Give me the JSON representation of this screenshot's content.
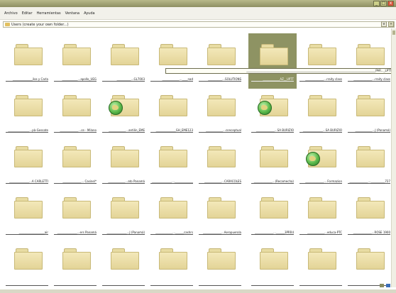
{
  "window": {
    "minimize": "_",
    "maximize": "□",
    "close": "x"
  },
  "menu": [
    "Archivo",
    "Editar",
    "Herramientas",
    "Ventana",
    "Ayuda"
  ],
  "address": {
    "text": "Users (create your own folder...)",
    "arrow": "v",
    "go": "»"
  },
  "rename_field": "___________________________________________________________________________________________PAR..._LPTT",
  "rows": [
    [
      {
        "label": "______________ilos y Carla",
        "globe": false
      },
      {
        "label": "___________...apollo_UEG",
        "globe": false
      },
      {
        "label": "__________...GL7003",
        "globe": false
      },
      {
        "label": "____________...____nad",
        "globe": false
      },
      {
        "label": "__________...SOLUTIONS",
        "globe": false
      },
      {
        "label": "____________AZ__UPTT",
        "globe": false,
        "selected": true
      },
      {
        "label": "_____________...rraity class",
        "globe": false
      },
      {
        "label": "_____________...rraity class",
        "globe": false
      }
    ],
    [
      {
        "label": "_______________...pà-Gessate",
        "globe": false
      },
      {
        "label": "_____________...ce - Milano",
        "globe": false
      },
      {
        "label": "____________...antilin_EME",
        "globe": true
      },
      {
        "label": "______________GH_EME123",
        "globe": false
      },
      {
        "label": "____________...conceptual",
        "globe": false
      },
      {
        "label": "_____________...SA BURIZIO",
        "globe": true
      },
      {
        "label": "______________...SA BURIZIO",
        "globe": false
      },
      {
        "label": "____________...J (Panamá)",
        "globe": false
      }
    ],
    [
      {
        "label": "______________...A CARLETTI",
        "globe": false
      },
      {
        "label": "_____________... Casinel*",
        "globe": false
      },
      {
        "label": "____________...ato Panamá",
        "globe": false
      },
      {
        "label": "______________..._____________",
        "globe": false
      },
      {
        "label": "____________...CARACOLES",
        "globe": false
      },
      {
        "label": "_____________...(Recamecha)",
        "globe": false
      },
      {
        "label": "_____________... Formazion",
        "globe": true
      },
      {
        "label": "_____________...__________727",
        "globe": false
      }
    ],
    [
      {
        "label": "__________________air",
        "globe": false
      },
      {
        "label": "______________...ers Panamá",
        "globe": false
      },
      {
        "label": "______________...J (Panamá)",
        "globe": false
      },
      {
        "label": "____________...______cashrs",
        "globe": false
      },
      {
        "label": "_____________...Aeropuerola",
        "globe": false
      },
      {
        "label": "_____________...______3PRR4",
        "globe": false
      },
      {
        "label": "____________...educa-PTC",
        "globe": false
      },
      {
        "label": "_____________...ROSE 1900",
        "globe": false
      }
    ],
    [
      {
        "label": "",
        "globe": false
      },
      {
        "label": "",
        "globe": false
      },
      {
        "label": "",
        "globe": false
      },
      {
        "label": "",
        "globe": false
      },
      {
        "label": "",
        "globe": false
      },
      {
        "label": "",
        "globe": false
      },
      {
        "label": "",
        "globe": false
      },
      {
        "label": "",
        "globe": false
      }
    ]
  ]
}
